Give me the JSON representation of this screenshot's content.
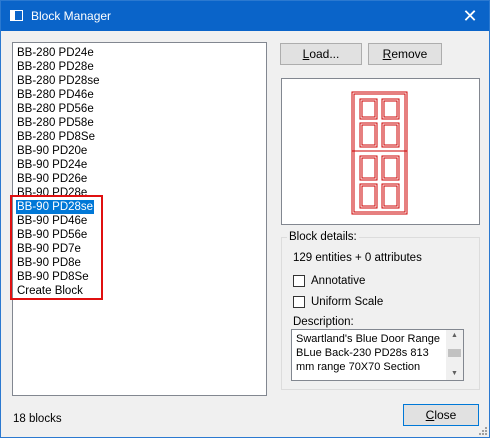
{
  "window": {
    "title": "Block Manager"
  },
  "blocks": {
    "items": [
      "BB-280 PD24e",
      "BB-280 PD28e",
      "BB-280 PD28se",
      "BB-280 PD46e",
      "BB-280 PD56e",
      "BB-280 PD58e",
      "BB-280 PD8Se",
      "BB-90 PD20e",
      "BB-90 PD24e",
      "BB-90 PD26e",
      "BB-90 PD28e",
      "BB-90 PD28se",
      "BB-90 PD46e",
      "BB-90 PD56e",
      "BB-90 PD7e",
      "BB-90 PD8e",
      "BB-90 PD8Se",
      "Create Block"
    ],
    "selected": "BB-90 PD28se"
  },
  "buttons": {
    "load": {
      "label": "Load...",
      "mnemonic": "L"
    },
    "remove": {
      "label": "Remove",
      "mnemonic": "R"
    },
    "close": {
      "label": "Close",
      "mnemonic": "C"
    }
  },
  "details": {
    "group_label": "Block details:",
    "entities": "129 entities + 0 attributes",
    "annotative_label": "Annotative",
    "annotative_checked": false,
    "uniform_scale_label": "Uniform Scale",
    "uniform_scale_checked": false,
    "description_label": "Description:",
    "description": "Swartland's Blue Door Range BLue Back-230  PD28s 813 mm range 70X70 Section"
  },
  "status": {
    "count": "18 blocks"
  },
  "colors": {
    "titlebar": "#0a64c9",
    "selection": "#0078d7",
    "annotation_box": "#e01010",
    "preview_lines": "#cc0000"
  }
}
